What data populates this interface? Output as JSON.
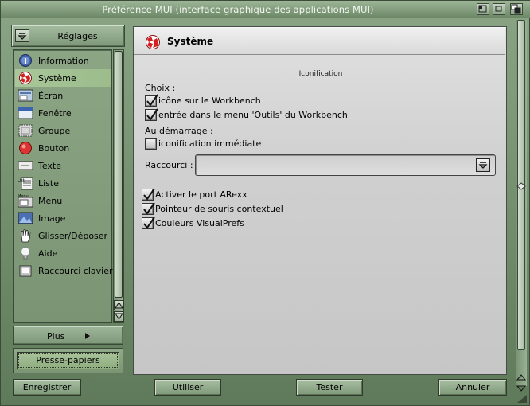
{
  "window": {
    "title": "Préférence MUI (interface graphique des applications MUI)"
  },
  "sidebar": {
    "header_label": "Réglages",
    "items": [
      {
        "label": "Information",
        "icon": "info-icon"
      },
      {
        "label": "Système",
        "icon": "boing-ball-icon",
        "selected": true
      },
      {
        "label": "Écran",
        "icon": "screen-icon"
      },
      {
        "label": "Fenêtre",
        "icon": "window-icon"
      },
      {
        "label": "Groupe",
        "icon": "group-icon"
      },
      {
        "label": "Bouton",
        "icon": "button-icon"
      },
      {
        "label": "Texte",
        "icon": "text-icon"
      },
      {
        "label": "Liste",
        "icon": "list-icon"
      },
      {
        "label": "Menu",
        "icon": "menu-icon"
      },
      {
        "label": "Image",
        "icon": "image-icon"
      },
      {
        "label": "Glisser/Déposer",
        "icon": "hand-icon"
      },
      {
        "label": "Aide",
        "icon": "bulb-icon"
      },
      {
        "label": "Raccourci clavier",
        "icon": "key-icon"
      }
    ],
    "plus_label": "Plus",
    "clipboard_label": "Presse-papiers"
  },
  "panel": {
    "title": "Système",
    "group_title": "Iconification",
    "choix_label": "Choix :",
    "choices": [
      {
        "label": "icône sur le Workbench",
        "checked": true
      },
      {
        "label": "entrée dans le menu 'Outils' du Workbench",
        "checked": true
      }
    ],
    "startup_label": "Au démarrage :",
    "startup_option": {
      "label": "iconification immédiate",
      "checked": false
    },
    "shortcut_label": "Raccourci :",
    "shortcut_value": "",
    "options": [
      {
        "label": "Activer le port ARexx",
        "checked": true
      },
      {
        "label": "Pointeur de souris contextuel",
        "checked": true
      },
      {
        "label": "Couleurs VisualPrefs",
        "checked": true
      }
    ]
  },
  "buttons": {
    "save": "Enregistrer",
    "use": "Utiliser",
    "test": "Tester",
    "cancel": "Annuler"
  }
}
